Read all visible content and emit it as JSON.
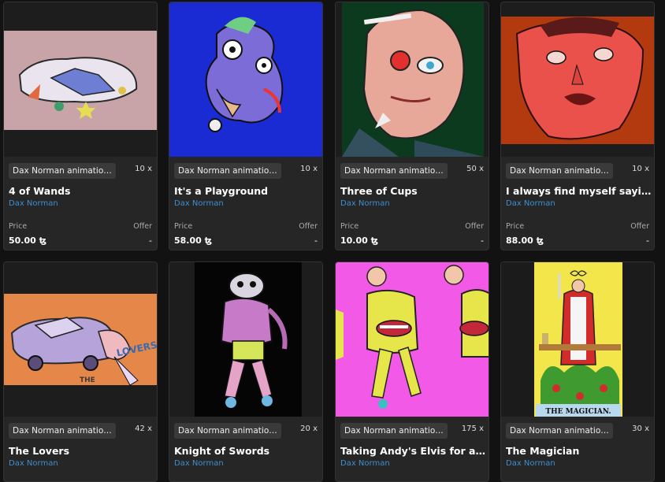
{
  "labels": {
    "price": "Price",
    "offer": "Offer"
  },
  "cards": [
    {
      "collection": "Dax Norman animation cl...",
      "count": "10 x",
      "title": "4 of Wands",
      "artist": "Dax Norman",
      "price": "50.00 ꜩ",
      "offer": "-"
    },
    {
      "collection": "Dax Norman animation cl...",
      "count": "10 x",
      "title": "It's a Playground",
      "artist": "Dax Norman",
      "price": "58.00 ꜩ",
      "offer": "-"
    },
    {
      "collection": "Dax Norman animation cl...",
      "count": "50 x",
      "title": "Three of Cups",
      "artist": "Dax Norman",
      "price": "10.00 ꜩ",
      "offer": "-"
    },
    {
      "collection": "Dax Norman animation cl...",
      "count": "10 x",
      "title": "I always find myself saying ...",
      "artist": "Dax Norman",
      "price": "88.00 ꜩ",
      "offer": "-"
    },
    {
      "collection": "Dax Norman animation cl...",
      "count": "42 x",
      "title": "The Lovers",
      "artist": "Dax Norman"
    },
    {
      "collection": "Dax Norman animation cl...",
      "count": "20 x",
      "title": "Knight of Swords",
      "artist": "Dax Norman"
    },
    {
      "collection": "Dax Norman animation cl...",
      "count": "175 x",
      "title": "Taking Andy's Elvis for a Walk",
      "artist": "Dax Norman"
    },
    {
      "collection": "Dax Norman animation cl...",
      "count": "30 x",
      "title": "The Magician",
      "artist": "Dax Norman",
      "art_caption": "THE MAGICIAN."
    }
  ]
}
